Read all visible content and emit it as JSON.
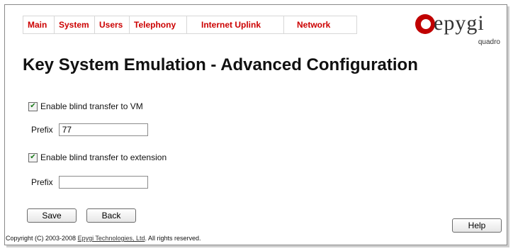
{
  "nav": {
    "items": [
      {
        "label": "Main"
      },
      {
        "label": "System"
      },
      {
        "label": "Users"
      },
      {
        "label": "Telephony"
      },
      {
        "label": "Internet Uplink"
      },
      {
        "label": "Network"
      }
    ]
  },
  "logo": {
    "brand": "epygi",
    "sub": "quadro"
  },
  "page": {
    "title": "Key System Emulation - Advanced Configuration"
  },
  "form": {
    "vm_checkbox_label": "Enable blind transfer to VM",
    "vm_checked": true,
    "vm_prefix_label": "Prefix",
    "vm_prefix_value": "77",
    "ext_checkbox_label": "Enable blind transfer to extension",
    "ext_checked": true,
    "ext_prefix_label": "Prefix",
    "ext_prefix_value": ""
  },
  "buttons": {
    "save": "Save",
    "back": "Back",
    "help": "Help"
  },
  "footer": {
    "prefix": "Copyright (C) 2003-2008",
    "link": "Epygi Technologies, Ltd",
    "suffix": ". All rights reserved."
  }
}
